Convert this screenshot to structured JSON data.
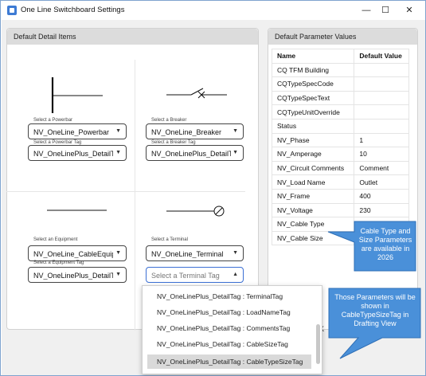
{
  "window": {
    "title": "One Line Switchboard Settings",
    "minimize_glyph": "—",
    "maximize_glyph": "☐",
    "close_glyph": "✕"
  },
  "left_panel": {
    "title": "Default Detail Items",
    "powerbar": {
      "label": "Select a Powerbar",
      "value": "NV_OneLine_Powerbar",
      "tag_label": "Select a Powerbar Tag",
      "tag_value": "NV_OneLinePlus_DetailT"
    },
    "breaker": {
      "label": "Select a Breaker",
      "value": "NV_OneLine_Breaker",
      "tag_label": "Select a Breaker Tag",
      "tag_value": "NV_OneLinePlus_DetailT"
    },
    "equipment": {
      "label": "Select an Equipment",
      "value": "NV_OneLine_CableEquip",
      "tag_label": "Select a Equipment Tag",
      "tag_value": "NV_OneLinePlus_DetailT"
    },
    "terminal": {
      "label": "Select a Terminal",
      "value": "NV_OneLine_Terminal",
      "tag_placeholder": "Select a Terminal Tag"
    }
  },
  "right_panel": {
    "title": "Default Parameter Values",
    "columns": [
      "Name",
      "Default Value"
    ],
    "rows": [
      {
        "name": "CQ TFM Building",
        "value": ""
      },
      {
        "name": "CQTypeSpecCode",
        "value": ""
      },
      {
        "name": "CQTypeSpecText",
        "value": ""
      },
      {
        "name": "CQTypeUnitOverride",
        "value": ""
      },
      {
        "name": "Status",
        "value": ""
      },
      {
        "name": "NV_Phase",
        "value": "1"
      },
      {
        "name": "NV_Amperage",
        "value": "10"
      },
      {
        "name": "NV_Circuit Comments",
        "value": "Comment"
      },
      {
        "name": "NV_Load Name",
        "value": "Outlet"
      },
      {
        "name": "NV_Frame",
        "value": "400"
      },
      {
        "name": "NV_Voltage",
        "value": "230"
      },
      {
        "name": "NV_Cable Type",
        "value": ""
      },
      {
        "name": "NV_Cable Size",
        "value": ""
      }
    ]
  },
  "dropdown": {
    "items": [
      "NV_OneLinePlus_DetailTag : TerminalTag",
      "NV_OneLinePlus_DetailTag : LoadNameTag",
      "NV_OneLinePlus_DetailTag : CommentsTag",
      "NV_OneLinePlus_DetailTag : CableSizeTag",
      "NV_OneLinePlus_DetailTag : CableTypeSizeTag"
    ],
    "selected_index": 4
  },
  "partial_button_text": "K",
  "callouts": {
    "top": "Cable Type and Size Parameters are available in 2026",
    "bottom": "Those Parameters will be shown in CableTypeSizeTag in Drafting View",
    "fill_color": "#4a90d9",
    "stroke_color": "#2f6fb6"
  }
}
